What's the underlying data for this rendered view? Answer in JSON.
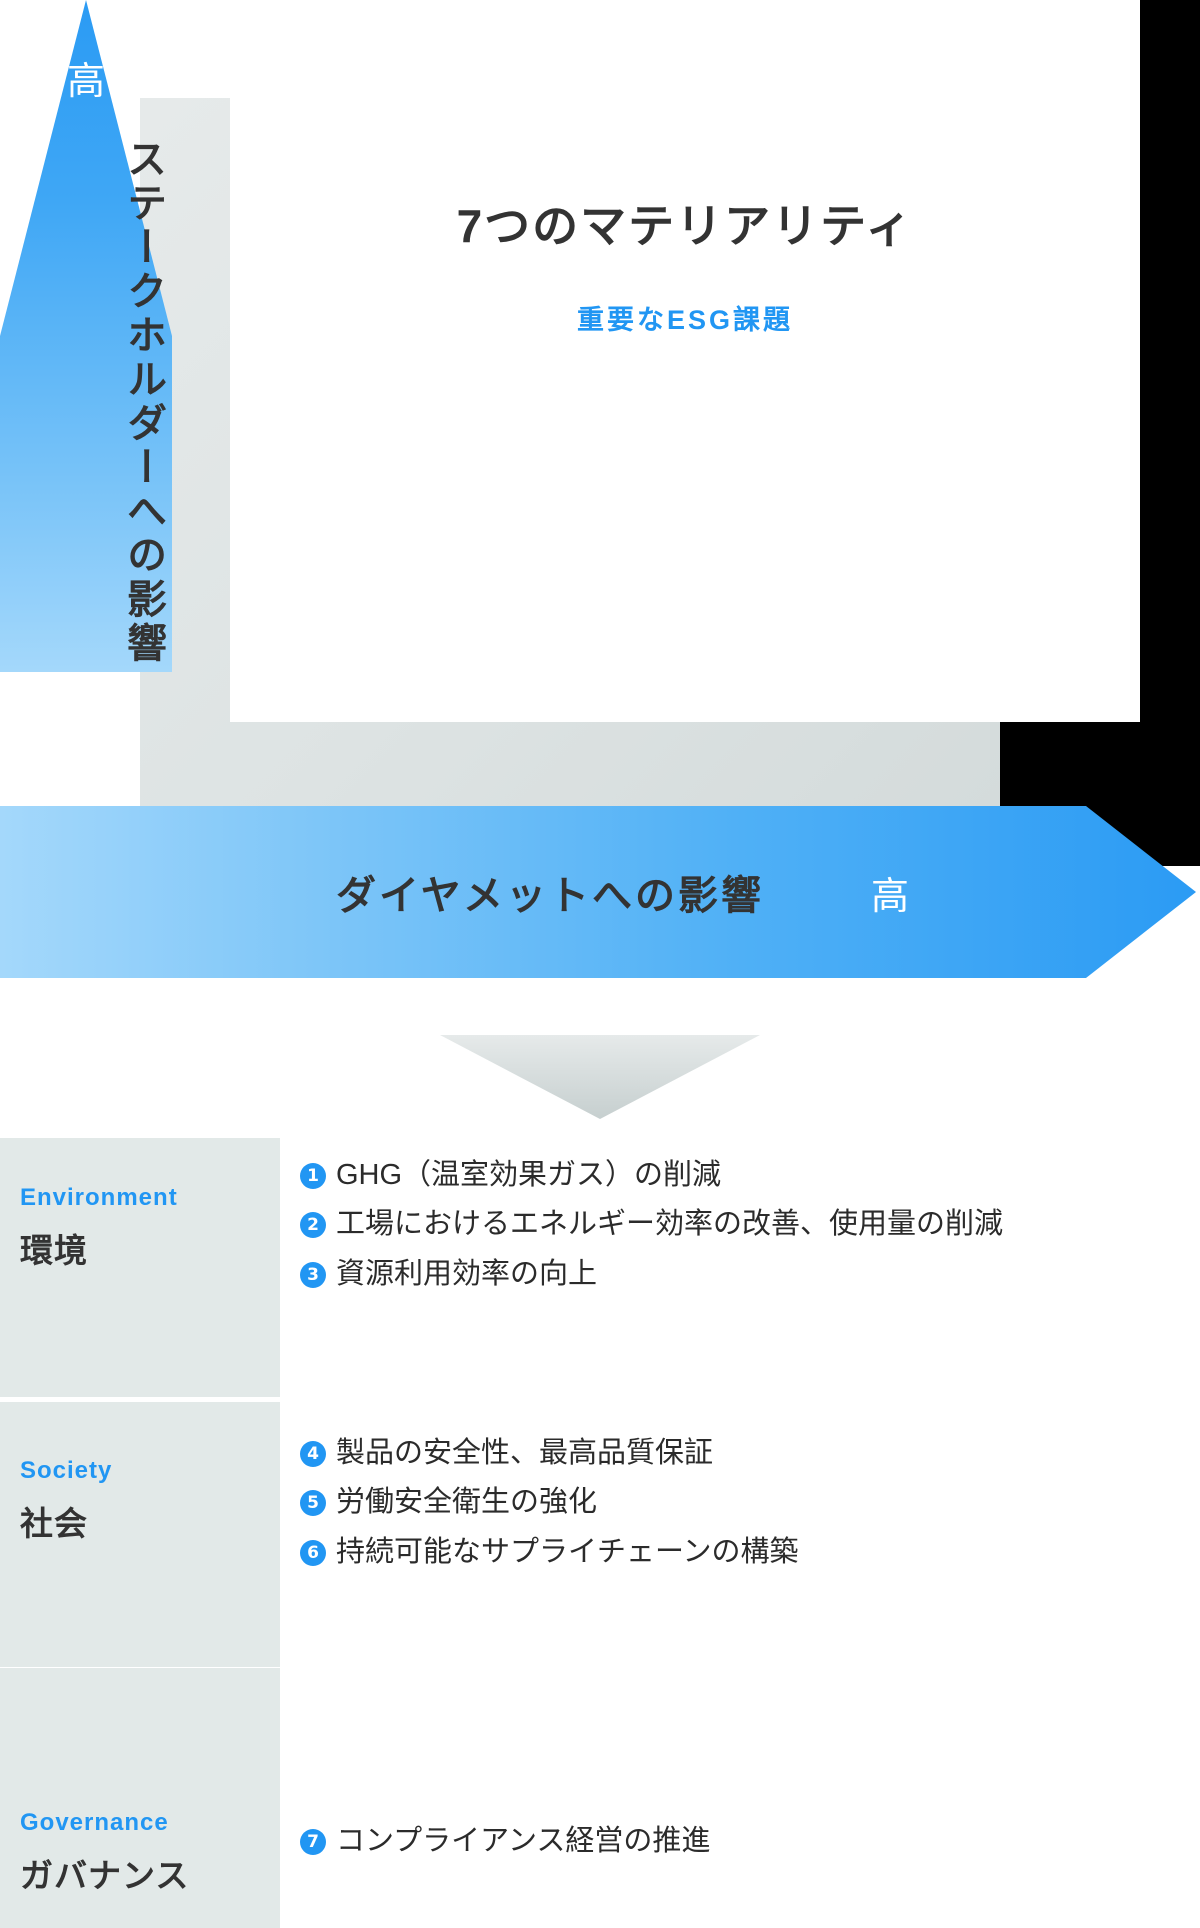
{
  "matrix": {
    "card": {
      "title": "7つのマテリアリティ",
      "subtitle": "重要なESG課題"
    },
    "y_axis": {
      "high_label": "高",
      "label": "ステークホルダーへの影響"
    },
    "x_axis": {
      "label": "ダイヤメットへの影響",
      "high_label": "高"
    }
  },
  "esg": {
    "rows": [
      {
        "en": "Environment",
        "ja": "環境",
        "items": [
          {
            "no": "❶",
            "text": "GHG（温室効果ガス）の削減"
          },
          {
            "no": "❷",
            "text": "工場におけるエネルギー効率の改善、使用量の削減"
          },
          {
            "no": "❸",
            "text": "資源利用効率の向上"
          }
        ]
      },
      {
        "en": "Society",
        "ja": "社会",
        "items": [
          {
            "no": "❹",
            "text": "製品の安全性、最高品質保証"
          },
          {
            "no": "❺",
            "text": "労働安全衛生の強化"
          },
          {
            "no": "❻",
            "text": "持続可能なサプライチェーンの構築"
          }
        ]
      },
      {
        "en": "Governance",
        "ja": "ガバナンス",
        "items": [
          {
            "no": "❼",
            "text": "コンプライアンス経営の推進"
          }
        ]
      }
    ]
  },
  "colors": {
    "accent_blue": "#2196f3",
    "arrow_blue_dark": "#2b9bf4",
    "arrow_blue_light": "#a4d8fb",
    "panel_grey": "#e2e9e8",
    "plate_grey": "#e0e6e6",
    "text_dark": "#333333"
  }
}
